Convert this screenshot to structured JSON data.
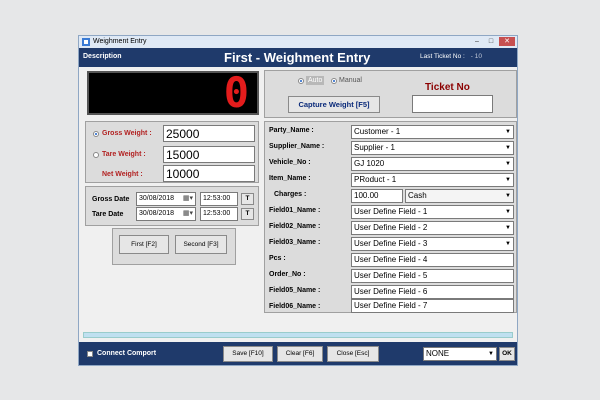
{
  "window": {
    "title": "Weighment Entry",
    "min": "–",
    "max": "□",
    "close": "✕"
  },
  "header": {
    "description": "Description",
    "page_title": "First - Weighment Entry",
    "last_ticket_label": "Last Ticket No :",
    "last_ticket_value": "- 10"
  },
  "display": {
    "weight_digit": "0"
  },
  "mode": {
    "auto_label": "Auto",
    "manual_label": "Manual",
    "capture_button": "Capture Weight [F5]",
    "ticket_no_label": "Ticket No",
    "ticket_no_value": ""
  },
  "weights": {
    "gross_label": "Gross Weight :",
    "gross_value": "25000",
    "tare_label": "Tare Weight  :",
    "tare_value": "15000",
    "net_label": "Net Weight :",
    "net_value": "10000"
  },
  "dates": {
    "gross_date_label": "Gross Date",
    "gross_date": "30/08/2018",
    "gross_time": "12:53:00",
    "tare_date_label": "Tare Date",
    "tare_date": "30/08/2018",
    "tare_time": "12:53:00",
    "t_button": "T"
  },
  "actions": {
    "first_button": "First [F2]",
    "second_button": "Second [F3]"
  },
  "fields": [
    {
      "label": "Party_Name :",
      "value": "Customer - 1"
    },
    {
      "label": "Supplier_Name :",
      "value": "Supplier - 1"
    },
    {
      "label": "Vehicle_No :",
      "value": "GJ 1020"
    },
    {
      "label": "Item_Name :",
      "value": "PRoduct - 1"
    },
    {
      "label": "Charges :",
      "value": "100.00",
      "mode": "Cash"
    },
    {
      "label": "Field01_Name :",
      "value": "User Define Field - 1"
    },
    {
      "label": "Field02_Name :",
      "value": "User Define Field - 2"
    },
    {
      "label": "Field03_Name :",
      "value": "User Define Field - 3"
    },
    {
      "label": "Pcs :",
      "value": "User Define Field - 4"
    },
    {
      "label": "Order_No :",
      "value": "User Define Field - 5"
    },
    {
      "label": "Field05_Name :",
      "value": "User Define Field - 6"
    },
    {
      "label": "Field06_Name :",
      "value": "User Define Field - 7"
    }
  ],
  "footer": {
    "connect_label": "Connect Comport",
    "save_button": "Save [F10]",
    "clear_button": "Clear [F6]",
    "close_button": "Close [Esc]",
    "port_value": "NONE",
    "ok_button": "OK"
  },
  "colors": {
    "header_bg": "#1f3a6b",
    "digit": "#e31c1c",
    "label_red": "#b22222"
  }
}
